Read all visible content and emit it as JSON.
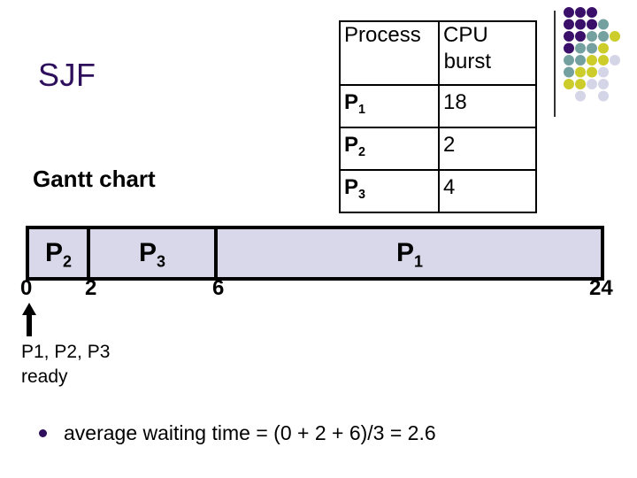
{
  "slide": {
    "title": "SJF",
    "gantt_heading": "Gantt chart",
    "accent_color": "#2e0f5c",
    "decoration": {
      "dot_colors": {
        "P": "#3a0f6a",
        "T": "#74a0a0",
        "Y": "#cccc2a",
        "L": "#d5d5e8"
      },
      "dot_grid": [
        "PPP",
        "PPPT",
        "PPTTY",
        "PTTY",
        "TTYYL",
        "TYYL",
        "YYLL",
        "_L_L"
      ]
    }
  },
  "process_table": {
    "headers": {
      "process": "Process",
      "burst_line1": "CPU",
      "burst_line2": "burst"
    },
    "rows": [
      {
        "name": "P",
        "sub": "1",
        "burst": "18"
      },
      {
        "name": "P",
        "sub": "2",
        "burst": "2"
      },
      {
        "name": "P",
        "sub": "3",
        "burst": "4"
      }
    ]
  },
  "chart_data": {
    "type": "gantt",
    "title": "Gantt chart",
    "segments": [
      {
        "process": "P",
        "sub": "2",
        "start": 0,
        "end": 2
      },
      {
        "process": "P",
        "sub": "3",
        "start": 2,
        "end": 6
      },
      {
        "process": "P",
        "sub": "1",
        "start": 6,
        "end": 24
      }
    ],
    "ticks": [
      "0",
      "2",
      "6",
      "24"
    ],
    "tick_values": [
      0,
      2,
      6,
      24
    ],
    "xlim": [
      0,
      24
    ],
    "bar_color": "#d8d8ea"
  },
  "annotation": {
    "arrow_at": 0,
    "line1": "P1, P2, P3",
    "line2": "ready"
  },
  "bullets": [
    {
      "text": "average waiting time = (0 + 2 + 6)/3 = 2.6"
    }
  ]
}
